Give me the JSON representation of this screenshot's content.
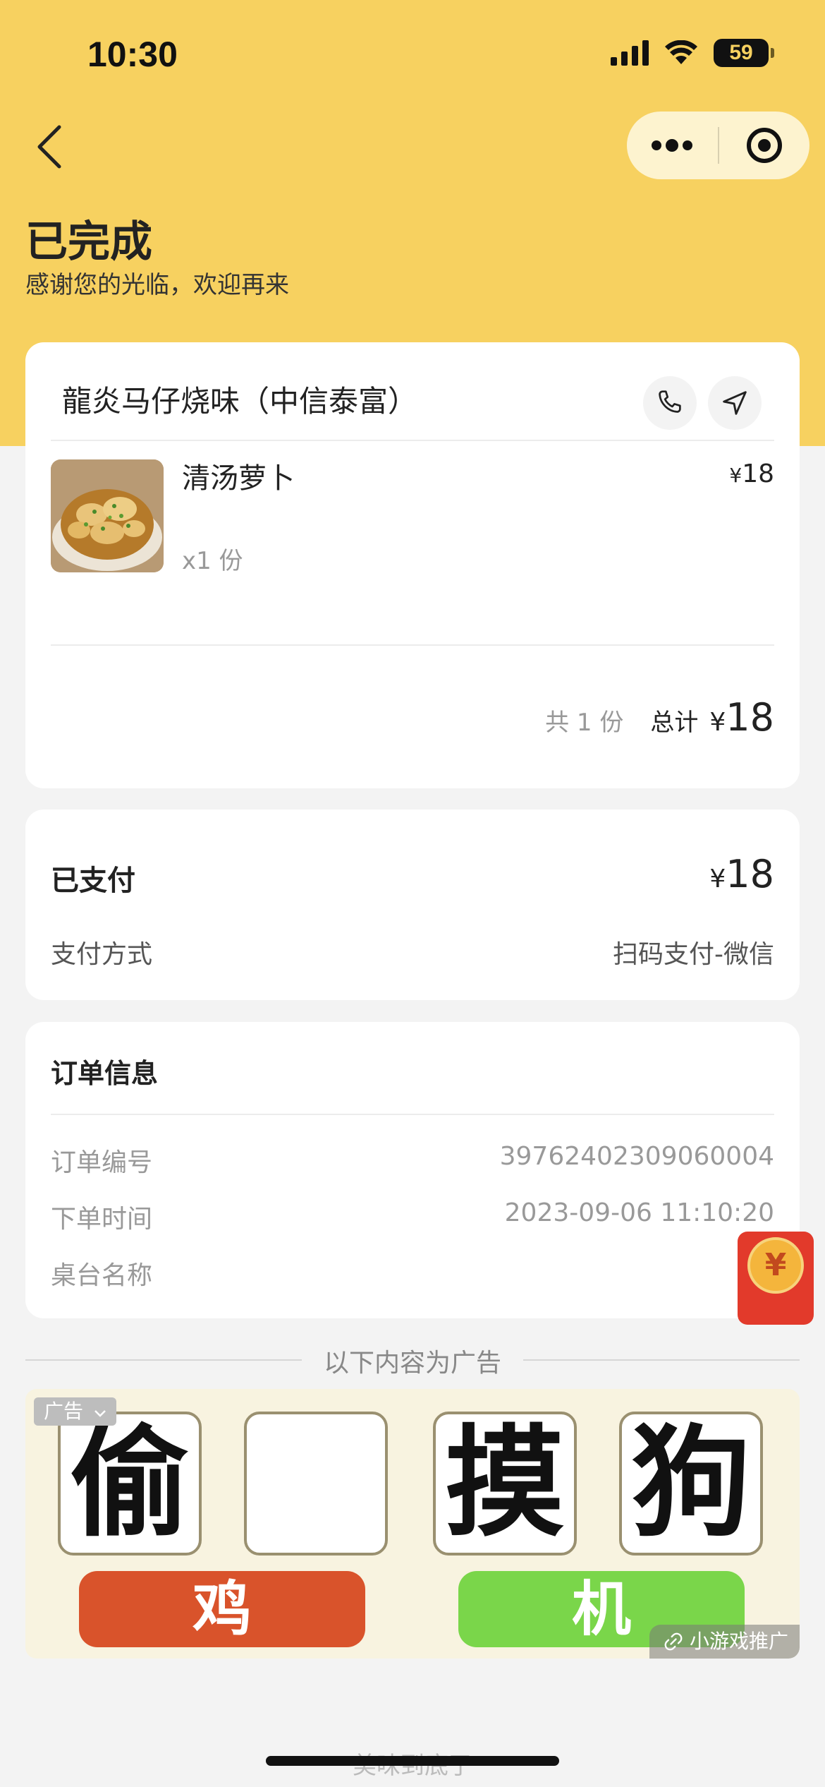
{
  "status_bar": {
    "time": "10:30",
    "battery": "59"
  },
  "header": {
    "title": "已完成",
    "subtitle": "感谢您的光临，欢迎再来"
  },
  "order": {
    "shop_name": "龍炎马仔烧味（中信泰富）",
    "items": [
      {
        "name": "清汤萝卜",
        "quantity": "x1 份",
        "price": "18"
      }
    ],
    "count_text": "共 1 份",
    "total_label": "总计",
    "currency": "¥",
    "total": "18"
  },
  "payment": {
    "paid_label": "已支付",
    "paid_amount": "18",
    "method_label": "支付方式",
    "method_value": "扫码支付-微信"
  },
  "order_info": {
    "title": "订单信息",
    "rows": [
      {
        "label": "订单编号",
        "value": "39762402309060004"
      },
      {
        "label": "下单时间",
        "value": "2023-09-06 11:10:20"
      },
      {
        "label": "桌台名称",
        "value": ""
      }
    ]
  },
  "redpacket": {
    "symbol": "¥"
  },
  "ad": {
    "divider_text": "以下内容为广告",
    "tag": "广告",
    "tiles": [
      "偷",
      "",
      "摸",
      "狗"
    ],
    "buttons": [
      "鸡",
      "机"
    ],
    "promo": "小游戏推广"
  },
  "footer": {
    "text": "美味到底了"
  },
  "colors": {
    "header_bg": "#f7d160",
    "page_bg": "#f3f3f3",
    "ad_button_red": "#d9532b",
    "ad_button_green": "#7ad64a"
  }
}
